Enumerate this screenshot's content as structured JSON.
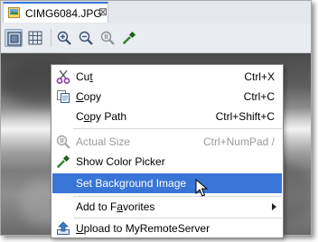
{
  "tab": {
    "title": "CIMG6084.JPG",
    "close": "⊠"
  },
  "toolbar": {
    "buttons": [
      {
        "icon": "zoom-fit-icon",
        "pressed": true
      },
      {
        "icon": "grid-icon",
        "pressed": false
      },
      {
        "icon": "zoom-in-icon",
        "pressed": false
      },
      {
        "icon": "zoom-out-icon",
        "pressed": false
      },
      {
        "icon": "actual-size-icon",
        "pressed": false
      },
      {
        "icon": "color-picker-icon",
        "pressed": false
      }
    ]
  },
  "menu": {
    "cut": {
      "pre": "Cu",
      "key": "t",
      "post": "",
      "shortcut": "Ctrl+X"
    },
    "copy": {
      "pre": "",
      "key": "C",
      "post": "opy",
      "shortcut": "Ctrl+C"
    },
    "copy_path": {
      "pre": "C",
      "key": "o",
      "post": "py Path",
      "shortcut": "Ctrl+Shift+C"
    },
    "actual_size": {
      "label": "Actual Size",
      "shortcut": "Ctrl+NumPad /"
    },
    "show_color_picker": {
      "label": "Show Color Picker"
    },
    "set_background": {
      "label": "Set Background Image"
    },
    "add_favorites": {
      "pre": "Add to F",
      "key": "a",
      "post": "vorites"
    },
    "upload": {
      "pre": "",
      "key": "U",
      "post": "pload to MyRemoteServer"
    }
  },
  "colors": {
    "accent": "#3875d7",
    "disabled": "#9a9a9a"
  }
}
